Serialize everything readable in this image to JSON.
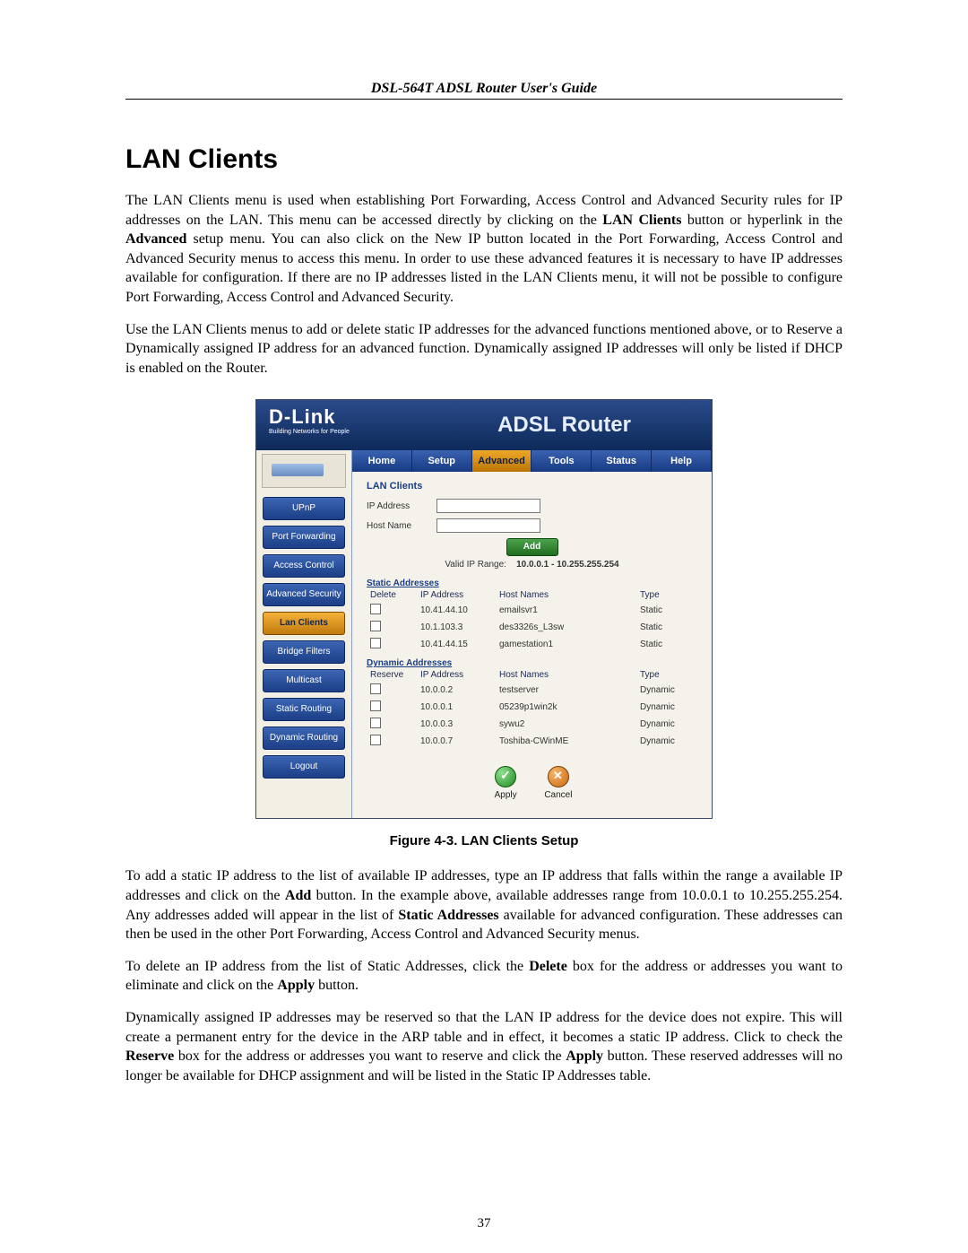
{
  "doc_header": "DSL-564T ADSL Router User's Guide",
  "h1": "LAN Clients",
  "para1_a": "The LAN Clients menu is used when establishing Port Forwarding, Access Control and Advanced Security rules for IP addresses on the LAN. This menu can be accessed directly by clicking on the ",
  "para1_b": "LAN Clients",
  "para1_c": " button or hyperlink in the ",
  "para1_d": "Advanced",
  "para1_e": " setup menu. You can also click on the New IP button located in the Port Forwarding, Access Control and Advanced Security menus to access this menu. In order to use these advanced features it is necessary to have IP addresses available for configuration. If there are no IP addresses listed in the LAN Clients menu, it will not be possible to configure Port Forwarding, Access Control and Advanced Security.",
  "para2": "Use the LAN Clients menus to add or delete static IP addresses for the advanced functions mentioned above, or to Reserve a Dynamically assigned IP address for an advanced function. Dynamically assigned IP addresses will only be listed if DHCP is enabled on the Router.",
  "router": {
    "brand": "D-Link",
    "brand_tag": "Building Networks for People",
    "title": "ADSL Router",
    "tabs": [
      "Home",
      "Setup",
      "Advanced",
      "Tools",
      "Status",
      "Help"
    ],
    "active_tab": 2,
    "sidebar": [
      "UPnP",
      "Port Forwarding",
      "Access Control",
      "Advanced Security",
      "Lan Clients",
      "Bridge Filters",
      "Multicast",
      "Static Routing",
      "Dynamic Routing",
      "Logout"
    ],
    "sidebar_active": 4,
    "section": "LAN Clients",
    "labels": {
      "ip": "IP Address",
      "host": "Host Name",
      "add": "Add"
    },
    "range_label": "Valid IP Range:",
    "range_value": "10.0.0.1 - 10.255.255.254",
    "static_header": "Static Addresses",
    "dynamic_header": "Dynamic Addresses",
    "cols_static": {
      "c1": "Delete",
      "c2": "IP Address",
      "c3": "Host Names",
      "c4": "Type"
    },
    "cols_dynamic": {
      "c1": "Reserve",
      "c2": "IP Address",
      "c3": "Host Names",
      "c4": "Type"
    },
    "static_rows": [
      {
        "ip": "10.41.44.10",
        "host": "emailsvr1",
        "type": "Static"
      },
      {
        "ip": "10.1.103.3",
        "host": "des3326s_L3sw",
        "type": "Static"
      },
      {
        "ip": "10.41.44.15",
        "host": "gamestation1",
        "type": "Static"
      }
    ],
    "dynamic_rows": [
      {
        "ip": "10.0.0.2",
        "host": "testserver",
        "type": "Dynamic"
      },
      {
        "ip": "10.0.0.1",
        "host": "05239p1win2k",
        "type": "Dynamic"
      },
      {
        "ip": "10.0.0.3",
        "host": "sywu2",
        "type": "Dynamic"
      },
      {
        "ip": "10.0.0.7",
        "host": "Toshiba-CWinME",
        "type": "Dynamic"
      }
    ],
    "actions": {
      "apply": "Apply",
      "cancel": "Cancel"
    }
  },
  "caption": "Figure 4-3. LAN Clients Setup",
  "para3_a": "To add a static IP address to the list of available IP addresses, type an IP address that falls within the range a available IP addresses and click on the ",
  "para3_b": "Add",
  "para3_c": " button. In the example above, available addresses range from 10.0.0.1 to 10.255.255.254. Any addresses added will appear in the list of ",
  "para3_d": "Static Addresses",
  "para3_e": " available for advanced configuration.  These addresses can then be used in the other Port Forwarding, Access Control and Advanced Security menus.",
  "para4_a": "To delete an IP address from the list of Static Addresses, click the ",
  "para4_b": "Delete",
  "para4_c": " box for the address or addresses you want to eliminate and click on the ",
  "para4_d": "Apply",
  "para4_e": " button.",
  "para5_a": "Dynamically assigned IP addresses may be reserved so that the LAN IP address for the device does not expire. This will create a permanent entry for the device in the ARP table and in effect, it becomes a static IP address. Click to check the ",
  "para5_b": "Reserve",
  "para5_c": " box for the address or addresses you want to reserve and click the ",
  "para5_d": "Apply",
  "para5_e": " button. These reserved addresses will no longer be available for DHCP assignment and will be listed in the Static IP Addresses table.",
  "page_number": "37"
}
